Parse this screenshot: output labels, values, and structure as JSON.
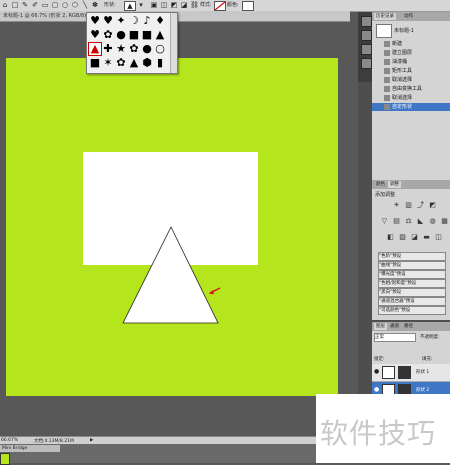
{
  "optbar": {
    "tool_icons": [
      "rect-shape-icon",
      "rounded-rect-icon",
      "ellipse-icon",
      "polygon-icon",
      "line-icon",
      "custom-shape-icon"
    ],
    "shape_label": "形状:",
    "style_label": "样式:",
    "color_label": "颜色:"
  },
  "document": {
    "tab_title": "未标题-1 @ 66.7% (形状 2, RGB/8) *"
  },
  "picker": {
    "shapes": [
      "♥",
      "♥",
      "✦",
      "☽",
      "♪",
      "♦",
      "♥",
      "✿",
      "●",
      "■",
      "■",
      "▲",
      "▲",
      "✚",
      "★",
      "✿",
      "●",
      "○",
      "■",
      "✶",
      "✿",
      "▲",
      "⬢",
      "▮"
    ]
  },
  "history": {
    "tabs": [
      "历史记录",
      "动作"
    ],
    "snapshot": "未标题-1",
    "items": [
      "新建",
      "建立图层",
      "油漆桶",
      "矩形工具",
      "取消选择",
      "自由变换工具",
      "取消选择",
      "自定形状"
    ]
  },
  "adjustments": {
    "tabs": [
      "颜色",
      "调整"
    ],
    "title": "添加调整",
    "presets": [
      "\"色阶\"预设",
      "\"曲线\"预设",
      "\"曝光度\"预设",
      "\"色相/饱和度\"预设",
      "\"黑白\"预设",
      "\"通道混合器\"预设",
      "\"可选颜色\"预设"
    ]
  },
  "layers": {
    "tabs": [
      "图层",
      "通道",
      "路径"
    ],
    "blend_mode": "正常",
    "opacity_label": "不透明度:",
    "lock_label": "锁定:",
    "fill_label": "填充:",
    "rows": [
      {
        "name": "形状 1"
      },
      {
        "name": "形状 2"
      }
    ]
  },
  "status": {
    "zoom": "66.67%",
    "doc": "文档:4.13M/8.21M"
  },
  "bottom": {
    "mini": "Mini Bridge"
  },
  "watermark": {
    "text": "软件技巧"
  },
  "colors": {
    "canvas": "#b5e61d",
    "selection": "#3f77c6"
  }
}
